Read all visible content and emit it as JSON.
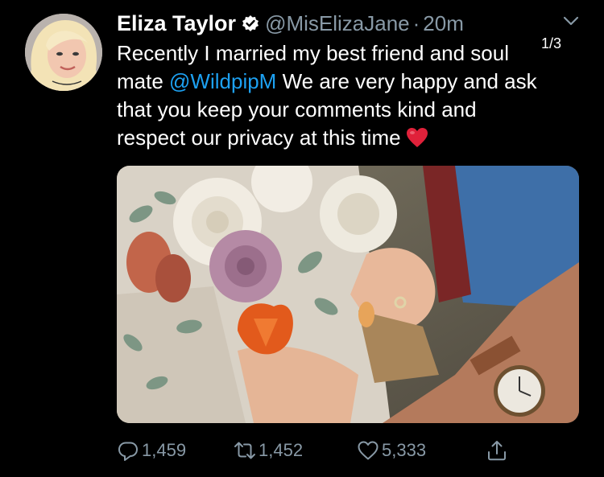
{
  "tweet": {
    "author_name": "Eliza Taylor",
    "handle": "@MisElizaJane",
    "separator": "·",
    "time": "20m",
    "thread_counter": "1/3",
    "text": {
      "line1": "Recently I married my best friend and soul",
      "line2_mention": "@WildpipM",
      "line2_pre": "mate ",
      "line2_post": " We are very happy and ask",
      "line3": "that you keep your comments kind and",
      "line4": "respect our privacy at this time"
    },
    "icons": {
      "verified": "verified-badge-icon",
      "more": "chevron-down-icon",
      "emoji": "red-heart-emoji"
    }
  },
  "actions": {
    "replies": "1,459",
    "retweets": "1,452",
    "likes": "5,333",
    "icons": [
      "reply-icon",
      "retweet-icon",
      "like-icon",
      "share-icon"
    ]
  },
  "colors": {
    "background": "#000000",
    "text": "#ffffff",
    "secondary": "#8899a6",
    "link": "#1da1f2"
  }
}
